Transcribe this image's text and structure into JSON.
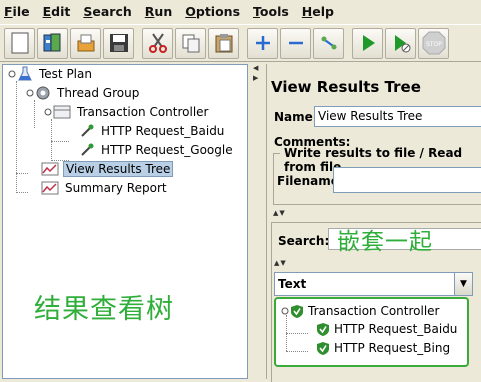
{
  "menu": [
    {
      "first": "F",
      "rest": "ile"
    },
    {
      "first": "E",
      "rest": "dit"
    },
    {
      "first": "S",
      "rest": "earch"
    },
    {
      "first": "R",
      "rest": "un"
    },
    {
      "first": "O",
      "rest": "ptions"
    },
    {
      "first": "T",
      "rest": "ools"
    },
    {
      "first": "H",
      "rest": "elp"
    }
  ],
  "toolbar": [
    "new-icon",
    "templates-icon",
    "open-icon",
    "save-icon",
    "cut-icon",
    "copy-icon",
    "paste-icon",
    "expand-icon",
    "collapse-icon",
    "toggle-icon",
    "start-icon",
    "start-no-pause-icon",
    "stop-icon"
  ],
  "tree": {
    "test_plan": "Test Plan",
    "thread_group": "Thread Group",
    "transaction_controller": "Transaction Controller",
    "request_baidu": "HTTP Request_Baidu",
    "request_google": "HTTP Request_Google",
    "view_results_tree": "View Results Tree",
    "summary_report": "Summary Report"
  },
  "annotation_left": "结果查看树",
  "annotation_right": "嵌套一起",
  "panel": {
    "title": "View Results Tree",
    "name_label": "Name:",
    "name_value": "View Results Tree",
    "comments_label": "Comments:",
    "write_results_title": "Write results to file / Read from file",
    "filename_label": "Filename",
    "search_label": "Search:",
    "renderer_value": "Text"
  },
  "results": {
    "transaction_controller": "Transaction Controller",
    "request_baidu": "HTTP Request_Baidu",
    "request_bing": "HTTP Request_Bing"
  },
  "colors": {
    "annotation": "#2fae3a",
    "success_shield": "#2f8f2f",
    "selection": "#b8cfe5"
  }
}
